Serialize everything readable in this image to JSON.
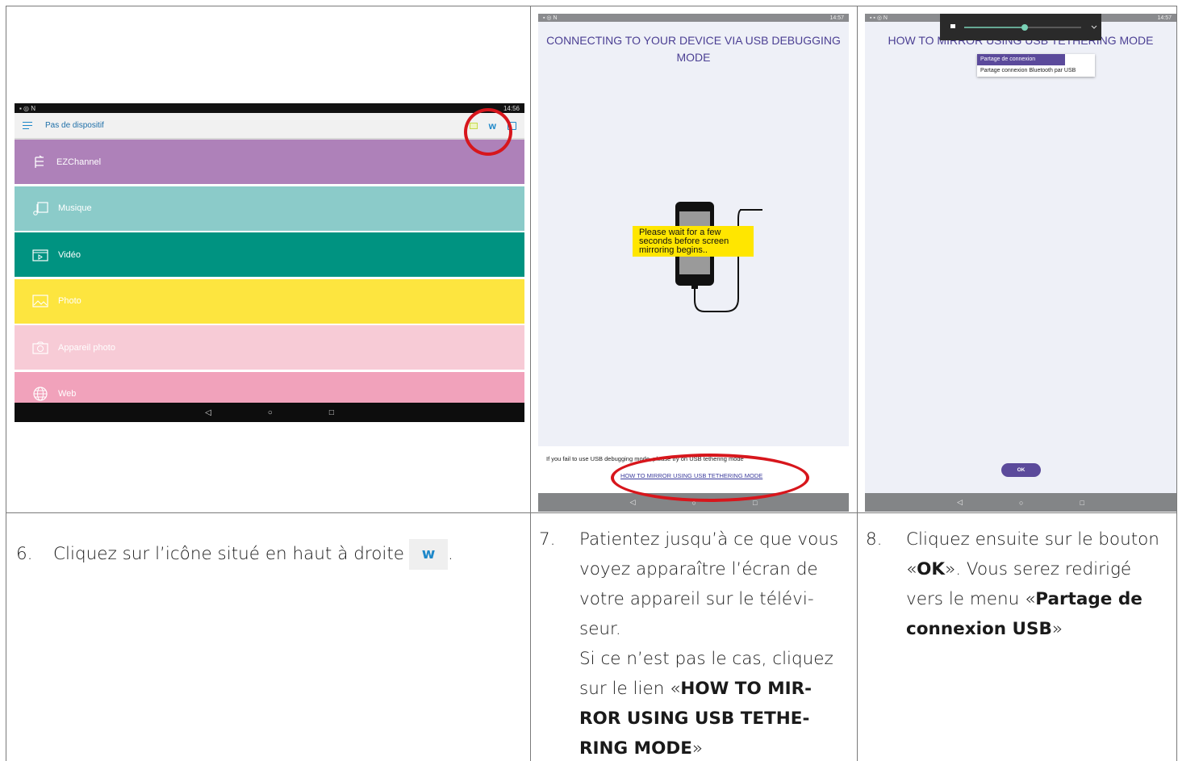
{
  "screen1": {
    "status_time": "14:56",
    "app_title": "Pas de dispositif",
    "menu": [
      {
        "label": "EZChannel",
        "color": "#ae81b9"
      },
      {
        "label": "Musique",
        "color": "#8bcbc9"
      },
      {
        "label": "Vidéo",
        "color": "#009381"
      },
      {
        "label": "Photo",
        "color": "#fde53f"
      },
      {
        "label": "Appareil photo",
        "color": "#f7cbd6"
      },
      {
        "label": "Web",
        "color": "#f1a2bb"
      }
    ],
    "nav": [
      "◁",
      "○",
      "□"
    ]
  },
  "screen2": {
    "status_time": "14:57",
    "title": "CONNECTING TO YOUR DEVICE VIA USB DEBUGGING MODE",
    "tooltip": "Please wait for a few seconds before screen mirroring begins..",
    "hint": "If you fail to use USB debugging mode, please try on USB tethering mode",
    "link": "HOW TO MIRROR USING USB TETHERING MODE",
    "nav": [
      "◁",
      "○",
      "□"
    ]
  },
  "screen3": {
    "status_time": "14:57",
    "title": "HOW TO MIRROR USING USB TETHERING MODE",
    "dropdown_selected": "Partage de connexion",
    "dropdown_option": "Partage connexion Bluetooth par USB",
    "ok_label": "OK",
    "nav": [
      "◁",
      "○",
      "□"
    ]
  },
  "captions": {
    "step6": {
      "num": "6.",
      "text": "Cliquez sur l’icône situé en haut à droite",
      "after": "."
    },
    "step7": {
      "num": "7.",
      "l1": "Patientez jusqu’à ce que vous",
      "l2": "voyez apparaître l’écran de",
      "l3": "votre appareil sur le télévi-",
      "l4": "seur.",
      "l5": "Si ce n’est pas le cas, cliquez",
      "l6a": "sur le lien «",
      "l6b": "HOW TO MIR-",
      "l7": "ROR USING USB TETHE-",
      "l8a": "RING MODE",
      "l8b": "»"
    },
    "step8": {
      "num": "8.",
      "l1": "Cliquez ensuite sur le bouton",
      "l2a": "«",
      "l2b": "OK",
      "l2c": "». Vous serez redirigé",
      "l3a": "vers le menu «",
      "l3b": "Partage de",
      "l4a": "connexion USB",
      "l4b": "»"
    }
  },
  "colors": {
    "accent_purple": "#4b3f93",
    "highlight_red": "#d7161c",
    "tooltip_yellow": "#ffe600"
  }
}
